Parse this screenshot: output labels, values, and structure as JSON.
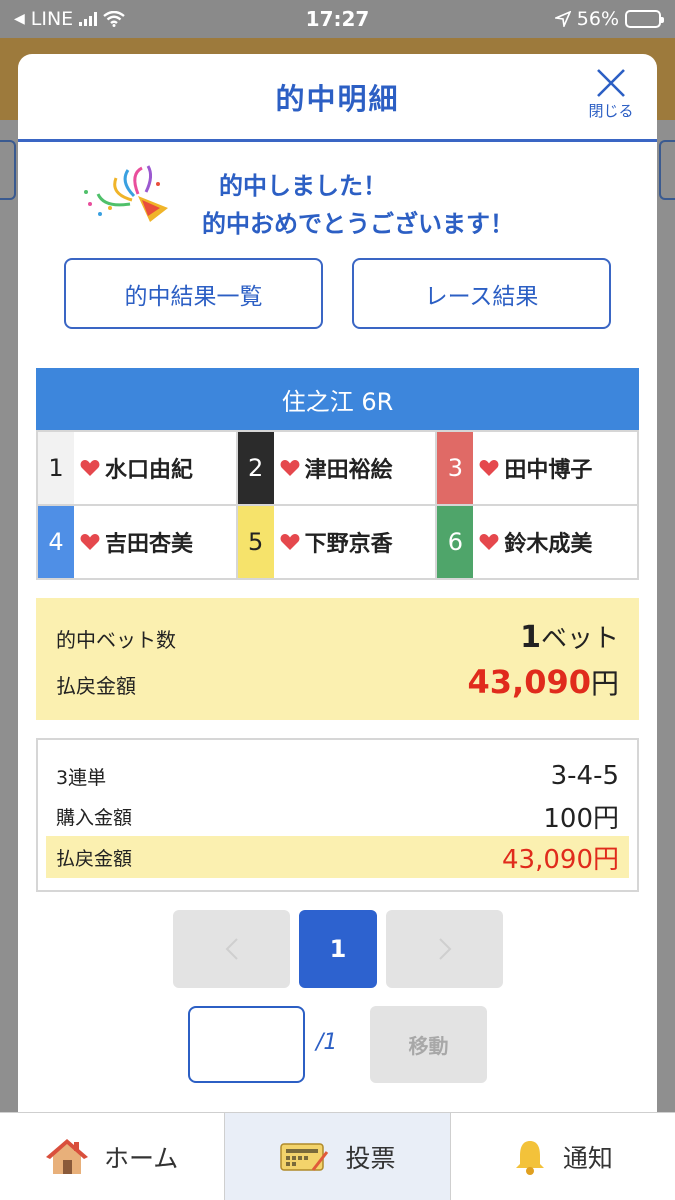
{
  "status_bar": {
    "back_app": "LINE",
    "time": "17:27",
    "battery": "56%"
  },
  "modal": {
    "title": "的中明細",
    "close_label": "閉じる",
    "message_line1": "的中しました！",
    "message_line2": "的中おめでとうございます！",
    "buttons": {
      "hit_list": "的中結果一覧",
      "race_result": "レース結果"
    }
  },
  "race": {
    "title": "住之江 6R",
    "players": [
      {
        "num": "1",
        "name": "水口由紀",
        "color": "#f2f2f2",
        "text_color": "#222222"
      },
      {
        "num": "2",
        "name": "津田裕絵",
        "color": "#2b2b2b",
        "text_color": "#ffffff"
      },
      {
        "num": "3",
        "name": "田中博子",
        "color": "#e06a66",
        "text_color": "#ffffff"
      },
      {
        "num": "4",
        "name": "吉田杏美",
        "color": "#4f8fe6",
        "text_color": "#ffffff"
      },
      {
        "num": "5",
        "name": "下野京香",
        "color": "#f6e36b",
        "text_color": "#222222"
      },
      {
        "num": "6",
        "name": "鈴木成美",
        "color": "#4fa56a",
        "text_color": "#ffffff"
      }
    ]
  },
  "summary": {
    "bet_count_label": "的中ベット数",
    "bet_count_value": "1",
    "bet_count_unit": "ベット",
    "payout_label": "払戻金額",
    "payout_value": "43,090",
    "payout_unit": "円"
  },
  "detail": {
    "type_label": "3連単",
    "type_value": "3-4-5",
    "purchase_label": "購入金額",
    "purchase_value": "100円",
    "payout_label": "払戻金額",
    "payout_value": "43,090円"
  },
  "pager": {
    "current": "1",
    "total": "/1",
    "move": "移動",
    "prev_icon": "chevron-left-icon",
    "next_icon": "chevron-right-icon"
  },
  "tabs": {
    "home": "ホーム",
    "vote": "投票",
    "notify": "通知"
  },
  "colors": {
    "accent": "#2c5fc4",
    "race_header": "#3d86dc",
    "highlight": "#fbf0b0",
    "payout": "#e02b1c"
  }
}
